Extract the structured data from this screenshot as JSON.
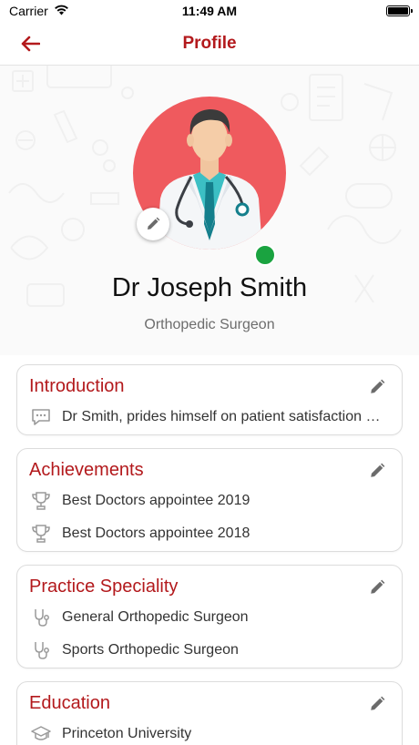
{
  "status_bar": {
    "carrier": "Carrier",
    "time": "11:49 AM",
    "battery_level": 1.0
  },
  "nav": {
    "title": "Profile",
    "back_icon": "arrow-left-icon"
  },
  "profile": {
    "name": "Dr Joseph Smith",
    "title": "Orthopedic Surgeon",
    "online": true
  },
  "colors": {
    "accent": "#b3191c",
    "avatar_bg": "#ef5a5e",
    "online": "#1aa340"
  },
  "sections": {
    "introduction": {
      "title": "Introduction",
      "icon": "comment-icon",
      "items": [
        "Dr Smith, prides himself on patient satisfaction and delivering the best care"
      ]
    },
    "achievements": {
      "title": "Achievements",
      "icon": "trophy-icon",
      "items": [
        "Best Doctors appointee 2019",
        "Best Doctors appointee 2018"
      ]
    },
    "speciality": {
      "title": "Practice Speciality",
      "icon": "stethoscope-icon",
      "items": [
        "General Orthopedic Surgeon",
        "Sports Orthopedic Surgeon"
      ]
    },
    "education": {
      "title": "Education",
      "icon": "graduation-cap-icon",
      "items": [
        "Princeton University"
      ]
    }
  }
}
